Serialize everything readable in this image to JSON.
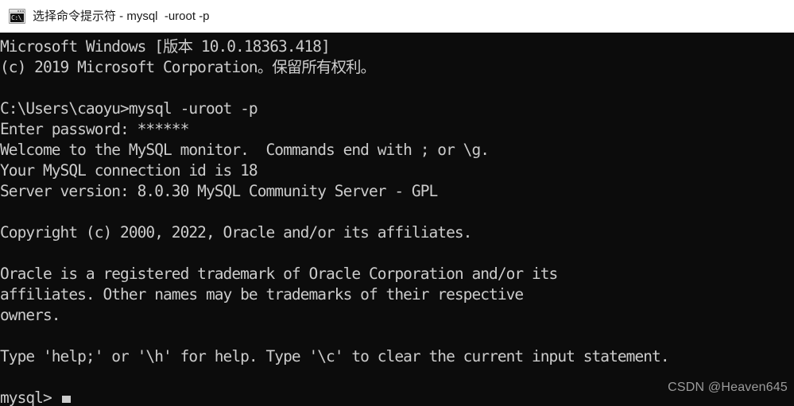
{
  "window": {
    "title": "选择命令提示符 - mysql  -uroot -p",
    "icon_label": "C:\\_",
    "icon_name": "console-icon"
  },
  "terminal": {
    "background_color": "#0c0c0c",
    "text_color": "#cccccc",
    "lines": [
      "Microsoft Windows [版本 10.0.18363.418]",
      "(c) 2019 Microsoft Corporation。保留所有权利。",
      "",
      "C:\\Users\\caoyu>mysql -uroot -p",
      "Enter password: ******",
      "Welcome to the MySQL monitor.  Commands end with ; or \\g.",
      "Your MySQL connection id is 18",
      "Server version: 8.0.30 MySQL Community Server - GPL",
      "",
      "Copyright (c) 2000, 2022, Oracle and/or its affiliates.",
      "",
      "Oracle is a registered trademark of Oracle Corporation and/or its",
      "affiliates. Other names may be trademarks of their respective",
      "owners.",
      "",
      "Type 'help;' or '\\h' for help. Type '\\c' to clear the current input statement.",
      ""
    ],
    "prompt": "mysql> ",
    "cursor_visible": true
  },
  "watermark": {
    "text": "CSDN @Heaven645",
    "color": "#9b9b9b"
  }
}
